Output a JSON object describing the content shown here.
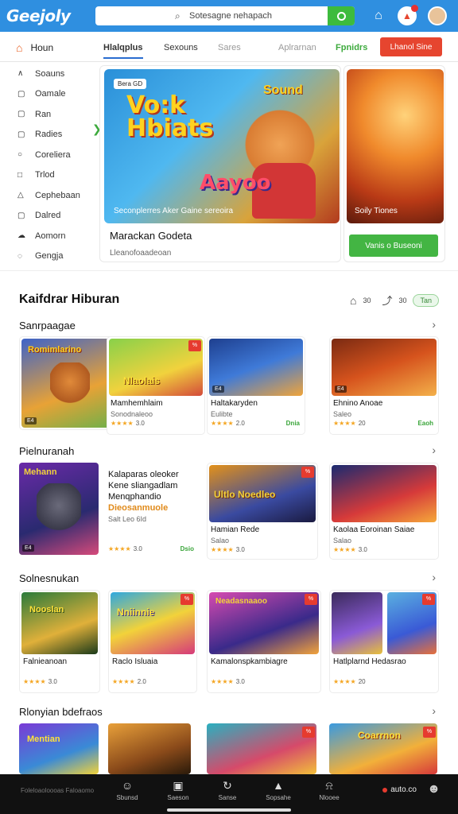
{
  "app": {
    "logo": "Geejoly"
  },
  "search": {
    "placeholder": "Sotesagne nehapach"
  },
  "nav": {
    "home": "Houn",
    "tabs": [
      {
        "label": "Hlalqplus"
      },
      {
        "label": "Sexouns"
      },
      {
        "label": "Sares"
      },
      {
        "label": "Aplrarnan"
      },
      {
        "label": "Fpnidrs"
      }
    ],
    "cta": "Lhanol Sine"
  },
  "sidebar": {
    "items": [
      {
        "label": "Soauns",
        "icon": "gamepad-icon"
      },
      {
        "label": "Oamale",
        "icon": "chat-icon"
      },
      {
        "label": "Ran",
        "icon": "chat-icon"
      },
      {
        "label": "Radies",
        "icon": "chat-icon"
      },
      {
        "label": "Coreliera",
        "icon": "circle-icon"
      },
      {
        "label": "Trlod",
        "icon": "square-icon"
      },
      {
        "label": "Cephebaan",
        "icon": "triangle-icon"
      },
      {
        "label": "Dalred",
        "icon": "square-icon"
      },
      {
        "label": "Aomorn",
        "icon": "cloud-icon"
      },
      {
        "label": "Gengja",
        "icon": "chat-icon"
      }
    ]
  },
  "hero": {
    "tag": "Bera GD",
    "big_line1": "Vo:k",
    "big_line2": "Hbiats",
    "big_art": "Aayoo",
    "corner_text": "Sound",
    "caption": "Seconplerres   Aker Gaine sereoira",
    "title": "Marackan Godeta",
    "subtitle": "Lleanofoaadeoan"
  },
  "hero_side": {
    "caption": "Soily Tiones",
    "button": "Vanis o Buseoni"
  },
  "section": {
    "title": "Kaifdrar Hiburan",
    "tool1": "30",
    "tool2": "30",
    "pill": "Tan"
  },
  "rows": [
    {
      "title": "Sanrpaagae",
      "cards": [
        {
          "title": "",
          "sub": "",
          "rating": "",
          "play": "",
          "tag": "",
          "hot": ""
        },
        {
          "title": "Mamhemhlaim",
          "sub": "Sonodnaleoo",
          "rating": "3.0",
          "play": "",
          "tag": "",
          "hot": "%"
        },
        {
          "title": "Haltakaryden",
          "sub": "Eulibte",
          "rating": "2.0",
          "play": "Dnia",
          "tag": "",
          "hot": ""
        },
        {
          "title": "Ehnino Anoae",
          "sub": "Saleo",
          "rating": "20",
          "play": "Eaoh",
          "tag": "",
          "hot": ""
        }
      ]
    },
    {
      "title": "Pielnuranah",
      "feature": {
        "line1": "Kalaparas oleoker",
        "line2": "Kene sliangadlam",
        "line3": "Menqphandio",
        "highlight": "Dieosanmuole",
        "sub": "Salt Leo 6Id",
        "rating": "3.0",
        "play": "Dsio"
      },
      "cards": [
        {
          "title": "Hamian Rede",
          "sub": "Salao",
          "rating": "3.0",
          "play": "",
          "tag": "",
          "hot": "%"
        },
        {
          "title": "Kaolaa Eoroinan Saiae",
          "sub": "Salao",
          "rating": "3.0",
          "play": "",
          "tag": "",
          "hot": ""
        }
      ]
    },
    {
      "title": "Solnesnukan",
      "cards": [
        {
          "title": "Falnieanoan",
          "sub": "",
          "rating": "3.0",
          "play": "",
          "tag": "",
          "hot": ""
        },
        {
          "title": "Raclo Isluaia",
          "sub": "",
          "rating": "2.0",
          "play": "",
          "tag": "",
          "hot": "%"
        },
        {
          "title": "Kamalonspkambiagre",
          "sub": "",
          "rating": "3.0",
          "play": "",
          "tag": "",
          "hot": "%"
        },
        {
          "title": "Hatlplarnd Hedasrao",
          "sub": "",
          "rating": "20",
          "play": "",
          "tag": "",
          "hot": "%"
        }
      ]
    },
    {
      "title": "Rlonyian bdefraos",
      "cards": [
        {
          "title": "",
          "sub": "",
          "rating": "",
          "play": "",
          "tag": "",
          "hot": ""
        },
        {
          "title": "",
          "sub": "",
          "rating": "",
          "play": "",
          "tag": "",
          "hot": ""
        },
        {
          "title": "",
          "sub": "",
          "rating": "",
          "play": "",
          "tag": "",
          "hot": "%"
        },
        {
          "title": "",
          "sub": "",
          "rating": "",
          "play": "",
          "tag": "",
          "hot": "%"
        }
      ]
    }
  ],
  "card_art": {
    "r1c1": "Romimlarino",
    "r1c2": "Nlaolais",
    "r2c1": "Mehann",
    "r2c3": "Ultlo Noedleo",
    "r3c1": "Nooslan",
    "r3c2": "Nniinnie",
    "r3c3": "Neadasnaaoo",
    "r4c1": "Mentian",
    "r4c4": "Coarrnon"
  },
  "bottom": {
    "left_text": "Foleloaoloooas Faloaomo",
    "items": [
      {
        "label": "Sbunsd",
        "icon": "face-icon"
      },
      {
        "label": "Saeson",
        "icon": "clapper-icon"
      },
      {
        "label": "Sanse",
        "icon": "refresh-icon"
      },
      {
        "label": "Sopsahe",
        "icon": "thumbs-icon"
      },
      {
        "label": "Nlooee",
        "icon": "bell-icon"
      }
    ],
    "right_text": "auto.co"
  },
  "colors": {
    "primary": "#2f8fe0",
    "accent": "#e6452f",
    "success": "#43b543"
  }
}
